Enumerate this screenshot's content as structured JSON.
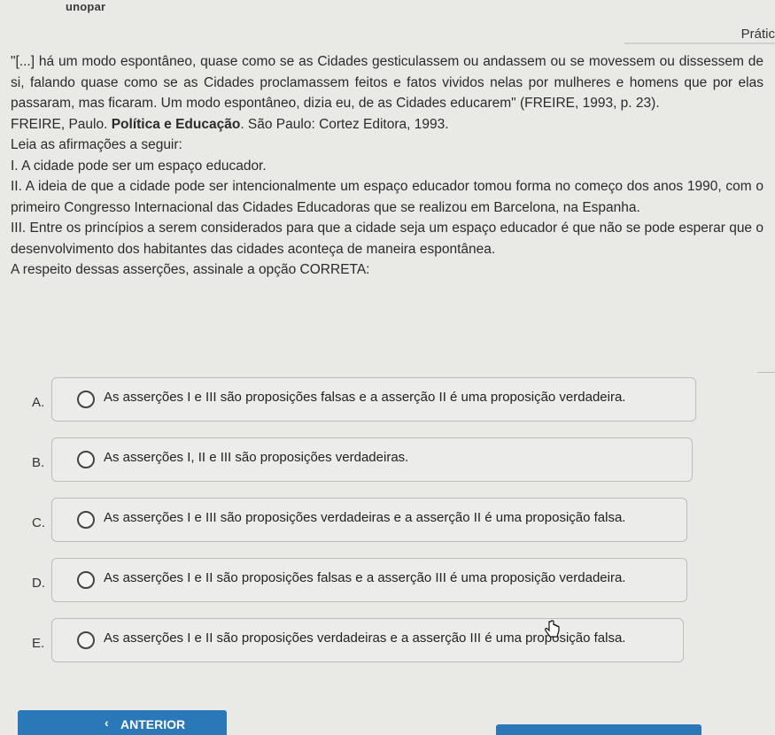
{
  "header": {
    "brand": "unopar",
    "tab": "Prátic"
  },
  "question": {
    "quote": "\"[...] há um modo espontâneo, quase como se as Cidades gesticulassem ou andassem ou se movessem ou dissessem de si, falando quase como se as Cidades proclamassem feitos e fatos vividos nelas por mulheres e homens que por elas passaram, mas ficaram. Um modo espontâneo, dizia eu, de as Cidades educarem\" (FREIRE, 1993, p. 23).",
    "reference_author": "FREIRE, Paulo.",
    "reference_title": "Política e Educação",
    "reference_rest": ". São Paulo: Cortez Editora, 1993.",
    "instruction": "Leia as afirmações a seguir:",
    "statements": [
      "I. A cidade pode ser um espaço educador.",
      "II. A ideia de que a cidade pode ser intencionalmente um espaço educador tomou forma no começo dos anos 1990, com o primeiro Congresso Internacional das Cidades Educadoras que se realizou em Barcelona, na Espanha.",
      "III. Entre os princípios a serem considerados para que a cidade seja um espaço educador é que não se pode esperar que o desenvolvimento dos habitantes das cidades aconteça de maneira espontânea."
    ],
    "prompt": "A respeito dessas asserções, assinale a opção CORRETA:"
  },
  "options": [
    {
      "letter": "A.",
      "text": "As asserções I e III são proposições falsas e a asserção II é uma proposição verdadeira."
    },
    {
      "letter": "B.",
      "text": "As asserções I, II e III são proposições verdadeiras."
    },
    {
      "letter": "C.",
      "text": "As asserções I e III são proposições verdadeiras e a asserção II é uma proposição falsa."
    },
    {
      "letter": "D.",
      "text": "As asserções I e II são proposições falsas e a asserção III é uma proposição verdadeira."
    },
    {
      "letter": "E.",
      "text": "As asserções I e II são proposições verdadeiras e a asserção III é uma proposição falsa."
    }
  ],
  "nav": {
    "prev_chevron": "‹",
    "prev_label": "ANTERIOR"
  },
  "colors": {
    "button": "#2a78b8",
    "background": "#e9e9e6"
  },
  "icons": {
    "cursor": "hand-pointer-icon"
  }
}
